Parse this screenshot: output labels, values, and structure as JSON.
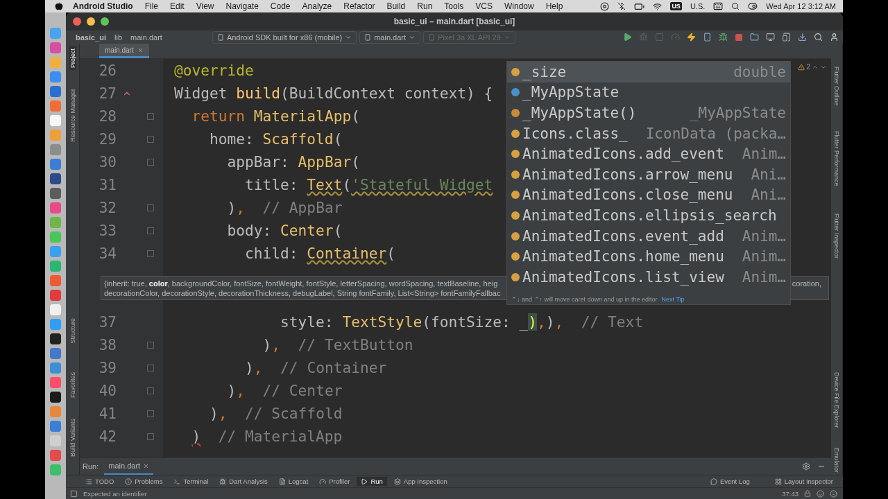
{
  "menubar": {
    "app": "Android Studio",
    "menus": [
      "File",
      "Edit",
      "View",
      "Navigate",
      "Code",
      "Analyze",
      "Refactor",
      "Build",
      "Run",
      "Tools",
      "VCS",
      "Window",
      "Help"
    ],
    "input_badge": "US",
    "input_name": "U.S.",
    "clock": "Wed Apr 12  3:12 AM"
  },
  "window": {
    "title": "basic_ui – main.dart [basic_ui]"
  },
  "navbar": {
    "breadcrumbs": [
      "basic_ui",
      "lib",
      "main.dart"
    ],
    "dropdowns": [
      {
        "label": "Android SDK built for x86 (mobile)",
        "disabled": false
      },
      {
        "label": "main.dart",
        "disabled": false
      },
      {
        "label": "Pixel 3a XL API 29",
        "disabled": true
      }
    ]
  },
  "left_tools": [
    {
      "label": "Project",
      "selected": true
    },
    {
      "label": "Resource Manager",
      "selected": false
    },
    {
      "label": "Structure",
      "selected": false
    },
    {
      "label": "Favorites",
      "selected": false
    },
    {
      "label": "Build Variants",
      "selected": false
    }
  ],
  "right_tools": [
    {
      "label": "Flutter Outline"
    },
    {
      "label": "Flutter Performance"
    },
    {
      "label": "Flutter Inspector"
    },
    {
      "label": "Device File Explorer"
    },
    {
      "label": "Emulator"
    }
  ],
  "editor_tabs": [
    {
      "label": "main.dart",
      "selected": true
    }
  ],
  "problems_count": "2",
  "code_lines": [
    {
      "kind": "code",
      "number": "26",
      "tokens": [
        {
          "text": "@override",
          "kind": "meta"
        }
      ]
    },
    {
      "kind": "code_override",
      "number": "27",
      "tokens": [
        {
          "text": "Widget ",
          "kind": "plain"
        },
        {
          "text": "build",
          "kind": "fn"
        },
        {
          "text": "(BuildContext context) {",
          "kind": "plain"
        }
      ]
    },
    {
      "kind": "code_fold",
      "number": "28",
      "tokens": [
        {
          "text": "  return",
          "kind": "kw"
        },
        {
          "text": " MaterialApp",
          "kind": "cls"
        },
        {
          "text": "(",
          "kind": "plain"
        }
      ]
    },
    {
      "kind": "code_fold",
      "number": "29",
      "tokens": [
        {
          "text": "    home: ",
          "kind": "plain"
        },
        {
          "text": "Scaffold",
          "kind": "cls"
        },
        {
          "text": "(",
          "kind": "plain"
        }
      ]
    },
    {
      "kind": "code_fold",
      "number": "30",
      "tokens": [
        {
          "text": "      appBar: ",
          "kind": "plain"
        },
        {
          "text": "AppBar",
          "kind": "cls"
        },
        {
          "text": "(",
          "kind": "plain"
        }
      ]
    },
    {
      "kind": "code",
      "number": "31",
      "tokens": [
        {
          "text": "        title: ",
          "kind": "plain"
        },
        {
          "text": "Text",
          "kind": "cls_warn"
        },
        {
          "text": "(",
          "kind": "plain"
        },
        {
          "text": "'Stateful Widget",
          "kind": "str_warn"
        }
      ]
    },
    {
      "kind": "code_fold",
      "number": "32",
      "tokens": [
        {
          "text": "      )",
          "kind": "plain"
        },
        {
          "text": ",",
          "kind": "punct"
        },
        {
          "text": "  // AppBar",
          "kind": "cmt"
        }
      ]
    },
    {
      "kind": "code_fold",
      "number": "33",
      "tokens": [
        {
          "text": "      body: ",
          "kind": "plain"
        },
        {
          "text": "Center",
          "kind": "cls"
        },
        {
          "text": "(",
          "kind": "plain"
        }
      ]
    },
    {
      "kind": "code_fold",
      "number": "34",
      "tokens": [
        {
          "text": "        child: ",
          "kind": "plain"
        },
        {
          "text": "Container",
          "kind": "cls_warn"
        },
        {
          "text": "(",
          "kind": "plain"
        }
      ]
    },
    {
      "kind": "parameter_info",
      "line_1": "{inherit: true, **color**, backgroundColor, fontSize, fontWeight, fontStyle, letterSpacing, wordSpacing, textBaseline, heig",
      "line_1_end": "coration,",
      "line_2": "decorationColor, decorationStyle, decorationThickness, debugLabel, String fontFamily, List<String> fontFamilyFallbac"
    },
    {
      "kind": "code",
      "number": "37",
      "tokens": [
        {
          "text": "            style: ",
          "kind": "plain"
        },
        {
          "text": "TextStyle",
          "kind": "cls"
        },
        {
          "text": "(fontSize: _",
          "kind": "plain"
        },
        {
          "text": ")",
          "kind": "match"
        },
        {
          "text": ",",
          "kind": "punct"
        },
        {
          "text": ")",
          "kind": "plain"
        },
        {
          "text": ",",
          "kind": "punct"
        },
        {
          "text": "  // Text",
          "kind": "cmt"
        }
      ]
    },
    {
      "kind": "code_fold",
      "number": "38",
      "tokens": [
        {
          "text": "          )",
          "kind": "plain"
        },
        {
          "text": ",",
          "kind": "punct"
        },
        {
          "text": "  // TextButton",
          "kind": "cmt"
        }
      ]
    },
    {
      "kind": "code_fold",
      "number": "39",
      "tokens": [
        {
          "text": "        )",
          "kind": "plain"
        },
        {
          "text": ",",
          "kind": "punct"
        },
        {
          "text": "  // Container",
          "kind": "cmt"
        }
      ]
    },
    {
      "kind": "code_fold",
      "number": "40",
      "tokens": [
        {
          "text": "      )",
          "kind": "plain"
        },
        {
          "text": ",",
          "kind": "punct"
        },
        {
          "text": "  // Center",
          "kind": "cmt"
        }
      ]
    },
    {
      "kind": "code_fold",
      "number": "41",
      "tokens": [
        {
          "text": "    )",
          "kind": "plain"
        },
        {
          "text": ",",
          "kind": "punct"
        },
        {
          "text": "  // Scaffold",
          "kind": "cmt"
        }
      ]
    },
    {
      "kind": "code_fold",
      "number": "42",
      "tokens": [
        {
          "text": "  )",
          "kind": "err"
        },
        {
          "text": "  // MaterialApp",
          "kind": "cmt"
        }
      ]
    }
  ],
  "completion": {
    "items": [
      {
        "kind": "field",
        "name": "_size",
        "type": "double",
        "selected": true
      },
      {
        "kind": "class",
        "name": "_MyAppState",
        "selected": false
      },
      {
        "kind": "method",
        "name": "_MyAppState()",
        "type": "_MyAppState",
        "selected": false
      },
      {
        "kind": "field",
        "name": "Icons.class_",
        "type": "IconData (packa…",
        "selected": false
      },
      {
        "kind": "field",
        "name": "AnimatedIcons.add_event",
        "type": "Anim…",
        "selected": false
      },
      {
        "kind": "field",
        "name": "AnimatedIcons.arrow_menu",
        "type": "Ani…",
        "selected": false
      },
      {
        "kind": "field",
        "name": "AnimatedIcons.close_menu",
        "type": "Ani…",
        "selected": false
      },
      {
        "kind": "field",
        "name": "AnimatedIcons.ellipsis_search",
        "selected": false
      },
      {
        "kind": "field",
        "name": "AnimatedIcons.event_add",
        "type": "Anim…",
        "selected": false
      },
      {
        "kind": "field",
        "name": "AnimatedIcons.home_menu",
        "type": "Anim…",
        "selected": false
      },
      {
        "kind": "field",
        "name": "AnimatedIcons.list_view",
        "type": "Anim…",
        "selected": false
      }
    ],
    "tip": "⌃↓ and ⌃↑ will move caret down and up in the editor",
    "tip_link": "Next Tip"
  },
  "run_bar": {
    "label": "Run:",
    "tabs": [
      {
        "label": "main.dart",
        "selected": true
      }
    ]
  },
  "tool_tabs": [
    {
      "kind": "todo",
      "label": "TODO",
      "selected": false
    },
    {
      "kind": "problems",
      "label": "Problems",
      "selected": false
    },
    {
      "kind": "terminal",
      "label": "Terminal",
      "selected": false
    },
    {
      "kind": "analysis",
      "label": "Dart Analysis",
      "selected": false
    },
    {
      "kind": "logcat",
      "label": "Logcat",
      "selected": false
    },
    {
      "kind": "profiler",
      "label": "Profiler",
      "selected": false
    },
    {
      "kind": "run",
      "label": "Run",
      "selected": true
    },
    {
      "kind": "inspection",
      "label": "App Inspection",
      "selected": false
    }
  ],
  "tool_tabs_right": [
    {
      "kind": "log",
      "label": "Event Log"
    },
    {
      "kind": "layout",
      "label": "Layout Inspector"
    }
  ],
  "status_bar": {
    "message": "Expected an identifier",
    "position": "37:43"
  }
}
